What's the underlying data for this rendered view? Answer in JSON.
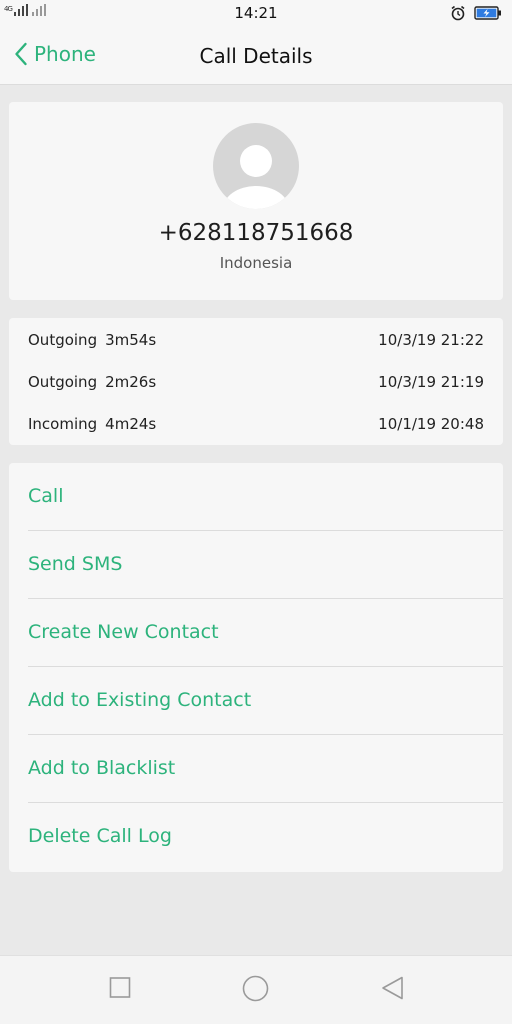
{
  "status_bar": {
    "network": "4G",
    "time": "14:21"
  },
  "nav": {
    "back_label": "Phone",
    "title": "Call Details"
  },
  "contact": {
    "number": "+628118751668",
    "country": "Indonesia"
  },
  "call_log": [
    {
      "type": "Outgoing",
      "duration": "3m54s",
      "datetime": "10/3/19 21:22"
    },
    {
      "type": "Outgoing",
      "duration": "2m26s",
      "datetime": "10/3/19 21:19"
    },
    {
      "type": "Incoming",
      "duration": "4m24s",
      "datetime": "10/1/19 20:48"
    }
  ],
  "actions": [
    {
      "label": "Call"
    },
    {
      "label": "Send SMS"
    },
    {
      "label": "Create New Contact"
    },
    {
      "label": "Add to Existing Contact"
    },
    {
      "label": "Add to Blacklist"
    },
    {
      "label": "Delete Call Log"
    }
  ],
  "colors": {
    "accent": "#2db37c",
    "background": "#e9e9e9",
    "card": "#f7f7f7"
  },
  "icons": {
    "back": "chevron-left-icon",
    "avatar": "person-icon",
    "alarm": "alarm-icon",
    "battery": "battery-charging-icon",
    "recents": "square-icon",
    "home": "circle-icon",
    "back_nav": "triangle-back-icon"
  }
}
